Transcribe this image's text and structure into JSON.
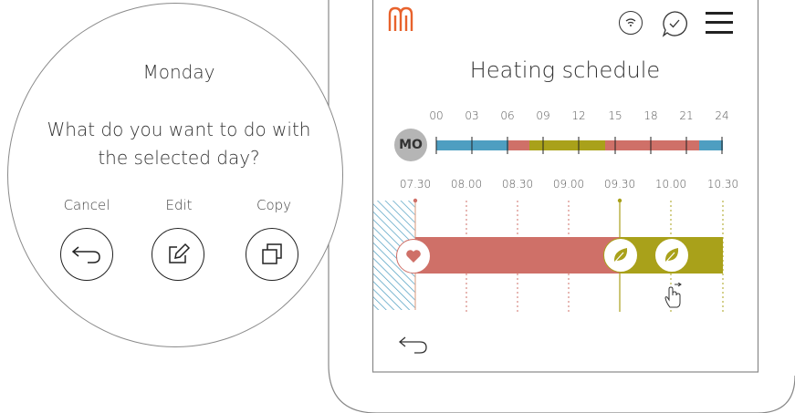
{
  "dialog": {
    "day": "Monday",
    "question_line1": "What do you want to do with",
    "question_line2": "the selected day?",
    "actions": [
      {
        "label": "Cancel",
        "icon": "undo-arrow-icon"
      },
      {
        "label": "Edit",
        "icon": "edit-pencil-icon"
      },
      {
        "label": "Copy",
        "icon": "copy-icon"
      }
    ]
  },
  "header": {
    "logo": "house-logo-icon",
    "icons": [
      "wifi-icon",
      "chat-check-icon",
      "hamburger-menu-icon"
    ],
    "title": "Heating schedule"
  },
  "day_overview": {
    "day_badge": "MO",
    "hours": [
      "00",
      "03",
      "06",
      "09",
      "12",
      "15",
      "18",
      "21",
      "24"
    ]
  },
  "timeline": {
    "times": [
      "07.30",
      "08.00",
      "08.30",
      "09.00",
      "09.30",
      "10.00",
      "10.30"
    ]
  },
  "colors": {
    "accent": "#e8622c",
    "comfort": "#cf7068",
    "eco": "#a9a11a",
    "night": "#4e9ec1",
    "badge": "#b5b5b5"
  }
}
